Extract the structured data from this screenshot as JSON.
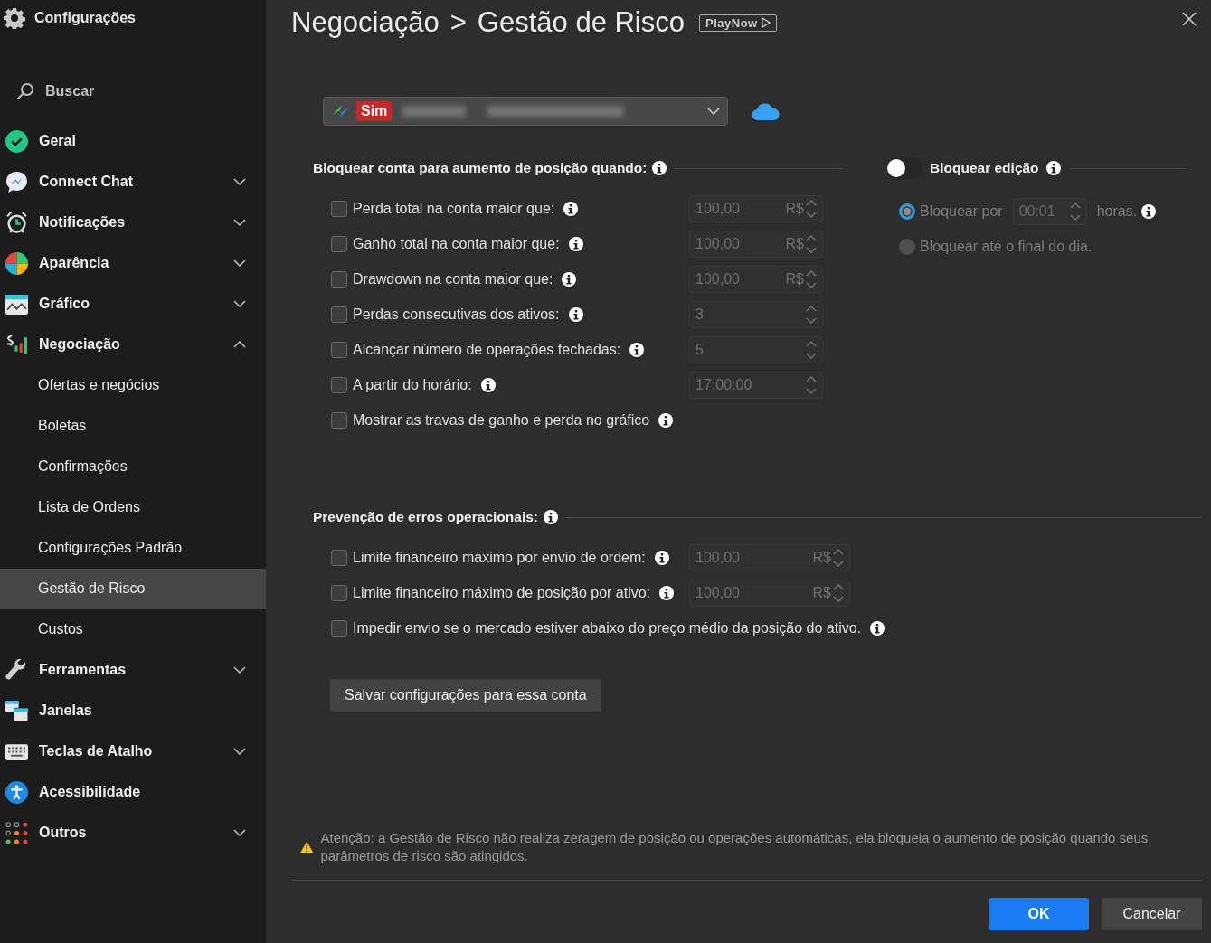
{
  "sidebar": {
    "title": "Configurações",
    "search": {
      "placeholder": "Buscar"
    },
    "items": [
      {
        "label": "Geral",
        "selected": false
      },
      {
        "label": "Connect Chat",
        "selected": false,
        "expanded": false
      },
      {
        "label": "Notificações",
        "selected": false,
        "expanded": false
      },
      {
        "label": "Aparência",
        "selected": false,
        "expanded": false
      },
      {
        "label": "Gráfico",
        "selected": false,
        "expanded": false
      },
      {
        "label": "Negociação",
        "selected": false,
        "expanded": true,
        "children": [
          {
            "label": "Ofertas e negócios",
            "selected": false
          },
          {
            "label": "Boletas",
            "selected": false
          },
          {
            "label": "Confirmações",
            "selected": false
          },
          {
            "label": "Lista de Ordens",
            "selected": false
          },
          {
            "label": "Configurações Padrão",
            "selected": false
          },
          {
            "label": "Gestão de Risco",
            "selected": true
          },
          {
            "label": "Custos",
            "selected": false
          }
        ]
      },
      {
        "label": "Ferramentas",
        "selected": false,
        "expanded": false
      },
      {
        "label": "Janelas",
        "selected": false
      },
      {
        "label": "Teclas de Atalho",
        "selected": false,
        "expanded": false
      },
      {
        "label": "Acessibilidade",
        "selected": false
      },
      {
        "label": "Outros",
        "selected": false,
        "expanded": false
      }
    ]
  },
  "header": {
    "breadcrumb": [
      "Negociação",
      ">",
      "Gestão de Risco"
    ],
    "badge": "PlayNow"
  },
  "account": {
    "tag": "Sim"
  },
  "lock_section": {
    "title": "Bloquear conta para aumento de posição quando:",
    "rows": [
      {
        "label": "Perda total na conta maior que:",
        "checked": false,
        "field": {
          "value": "100,00",
          "unit": "R$"
        }
      },
      {
        "label": "Ganho total na conta maior que:",
        "checked": false,
        "field": {
          "value": "100,00",
          "unit": "R$"
        }
      },
      {
        "label": "Drawdown na conta maior que:",
        "checked": false,
        "field": {
          "value": "100,00",
          "unit": "R$"
        }
      },
      {
        "label": "Perdas consecutivas dos ativos:",
        "checked": false,
        "field": {
          "value": "3"
        }
      },
      {
        "label": "Alcançar número de operações fechadas:",
        "checked": false,
        "field": {
          "value": "5"
        }
      },
      {
        "label": "A partir do horário:",
        "checked": false,
        "field": {
          "value": "17:00:00"
        }
      },
      {
        "label": "Mostrar as travas de ganho e perda no gráfico",
        "checked": false
      }
    ]
  },
  "edit_lock": {
    "title": "Bloquear edição",
    "on": false,
    "disabled": true,
    "options": [
      {
        "label": "Bloquear por",
        "selected": true,
        "field": "00:01",
        "suffix": "horas."
      },
      {
        "label": "Bloquear até o final do dia.",
        "selected": false
      }
    ]
  },
  "prevention_section": {
    "title": "Prevenção de erros operacionais:",
    "rows": [
      {
        "label": "Limite financeiro máximo por envio de ordem:",
        "checked": false,
        "field": {
          "value": "100,00",
          "unit": "R$"
        }
      },
      {
        "label": "Limite financeiro máximo de posição por ativo:",
        "checked": false,
        "field": {
          "value": "100,00",
          "unit": "R$"
        }
      },
      {
        "label": "Impedir envio se o mercado estiver abaixo do preço médio da posição do ativo.",
        "checked": false
      }
    ]
  },
  "save_button": "Salvar configurações para essa conta",
  "warning": "Atenção: a Gestão de Risco não realiza zeragem de posição ou operações automáticas, ela bloqueia o aumento de posição quando seus parâmetros de risco são atingidos.",
  "buttons": [
    {
      "label": "OK",
      "kind": "primary"
    },
    {
      "label": "Cancelar",
      "kind": "secondary"
    }
  ]
}
